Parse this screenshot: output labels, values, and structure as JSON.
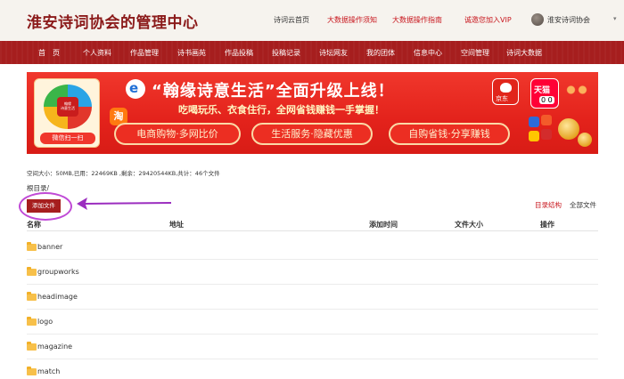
{
  "header": {
    "site_title": "淮安诗词协会的管理中心",
    "links": [
      {
        "label": "诗词云首页",
        "color": "#333333"
      },
      {
        "label": "大数据操作须知",
        "color": "#c8161d"
      },
      {
        "label": "大数据操作指南",
        "color": "#c8161d"
      },
      {
        "label": "诚邀您加入VIP",
        "color": "#c8161d"
      }
    ],
    "user_name": "淮安诗词协会",
    "caret": "▾"
  },
  "nav": {
    "items": [
      "首　页",
      "个人资料",
      "作品管理",
      "诗书画苑",
      "作品投稿",
      "投稿记录",
      "诗坛网友",
      "我的团体",
      "信息中心",
      "空间管理",
      "诗词大数据"
    ]
  },
  "banner": {
    "qr_center": "翰缘\n诗意生活",
    "qr_label": "微信扫一扫",
    "e_logo": "e",
    "taobao": "淘",
    "headline": "“翰缘诗意生活”全面升级上线！",
    "subline": "吃喝玩乐、衣食住行，全网省钱赚钱一手掌握！",
    "pills": [
      "电商购物·多网比价",
      "生活服务·隐藏优惠",
      "自购省钱·分享赚钱"
    ],
    "jd_label": "京东",
    "tmall_label": "天猫",
    "tmall_eyes": "0 0"
  },
  "storage_info": "空间大小：50MB,已用：22469KB ,剩余：29420544KB,共计：46个文件",
  "breadcrumb": "根目录/",
  "add_button": "添加文件",
  "right_links": [
    {
      "label": "目录结构",
      "color": "#c8161d"
    },
    {
      "label": "全部文件",
      "color": "#333333"
    }
  ],
  "table": {
    "headers": [
      "名称",
      "地址",
      "添加时间",
      "文件大小",
      "操作"
    ],
    "rows": [
      "banner",
      "groupworks",
      "headimage",
      "logo",
      "magazine",
      "match"
    ]
  },
  "colors": {
    "brand_red": "#a61e1e",
    "link_red": "#c8161d",
    "highlight": "#c04ad6",
    "folder": "#f7c04a"
  }
}
